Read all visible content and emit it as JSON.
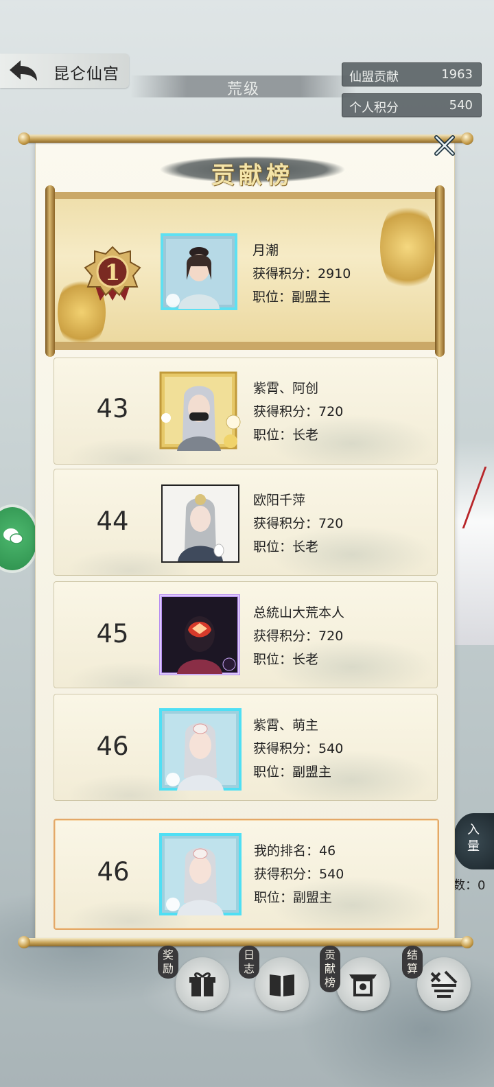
{
  "header": {
    "sect_name": "昆仑仙宫",
    "level": "荒级",
    "stats": [
      {
        "label": "仙盟贡献",
        "value": "1963"
      },
      {
        "label": "个人积分",
        "value": "540"
      }
    ]
  },
  "panel": {
    "title": "贡献榜",
    "top_player": {
      "rank": "1",
      "name": "月潮",
      "score_label": "获得积分：",
      "score": "2910",
      "position_label": "职位：",
      "position": "副盟主"
    },
    "rows": [
      {
        "rank": "43",
        "name": "紫霄、阿创",
        "score_label": "获得积分：",
        "score": "720",
        "position_label": "职位：",
        "position": "长老"
      },
      {
        "rank": "44",
        "name": "欧阳千萍",
        "score_label": "获得积分：",
        "score": "720",
        "position_label": "职位：",
        "position": "长老"
      },
      {
        "rank": "45",
        "name": "总統山大荒本人",
        "score_label": "获得积分：",
        "score": "720",
        "position_label": "职位：",
        "position": "长老"
      },
      {
        "rank": "46",
        "name": "紫霄、萌主",
        "score_label": "获得积分：",
        "score": "540",
        "position_label": "职位：",
        "position": "副盟主"
      }
    ],
    "my_row": {
      "rank": "46",
      "name_label": "我的排名：",
      "my_rank": "46",
      "score_label": "获得积分：",
      "score": "540",
      "position_label": "职位：",
      "position": "副盟主"
    }
  },
  "side": {
    "join_label_1": "入",
    "join_label_2": "量",
    "count_text": "数：0"
  },
  "nav": [
    {
      "label": "奖励",
      "icon": "gift-icon"
    },
    {
      "label": "日志",
      "icon": "book-icon"
    },
    {
      "label": "贡献榜",
      "icon": "ranking-icon"
    },
    {
      "label": "结算",
      "icon": "settlement-icon"
    }
  ]
}
